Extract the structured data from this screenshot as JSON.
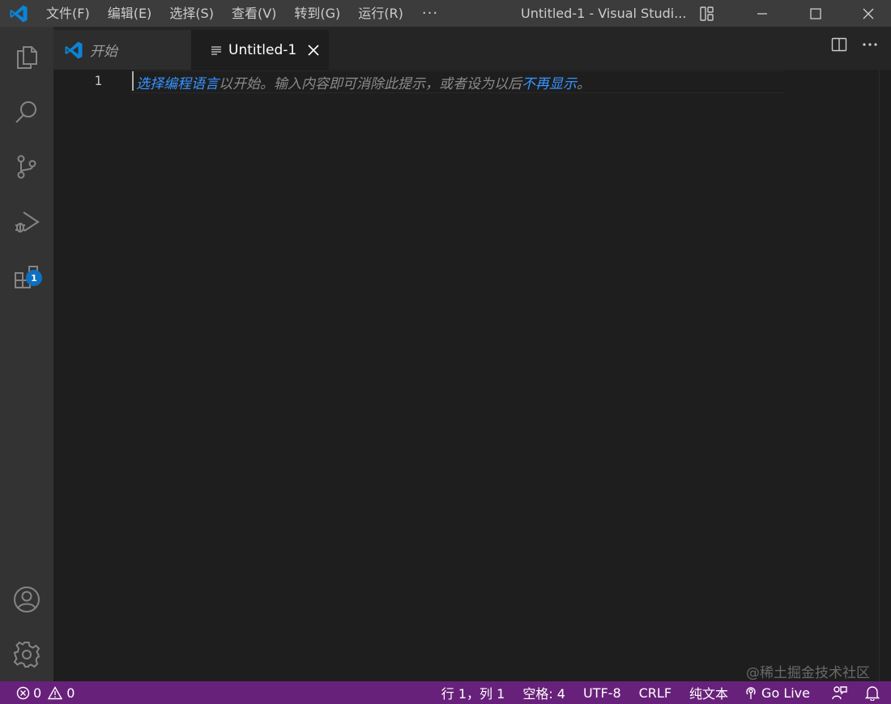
{
  "menu": {
    "items": [
      "文件(F)",
      "编辑(E)",
      "选择(S)",
      "查看(V)",
      "转到(G)",
      "运行(R)"
    ],
    "more_label": "···"
  },
  "window": {
    "title": "Untitled-1 - Visual Studi..."
  },
  "activity_bar": {
    "extensions_badge": "1"
  },
  "tabs": [
    {
      "label": "开始",
      "italic": true,
      "icon": "vscode-logo-icon"
    },
    {
      "label": "Untitled-1",
      "active": true,
      "icon": "file-lines-icon"
    }
  ],
  "editor": {
    "line_numbers": [
      "1"
    ],
    "hint": {
      "link1": "选择编程语言",
      "text1": "以开始。输入内容即可消除此提示，或者设为以后",
      "link2": "不再显示",
      "text2": "。"
    }
  },
  "status_bar": {
    "errors": "0",
    "warnings": "0",
    "position": "行 1，列 1",
    "indent": "空格: 4",
    "encoding": "UTF-8",
    "eol": "CRLF",
    "language": "纯文本",
    "go_live": "Go Live"
  },
  "watermark": "@稀土掘金技术社区",
  "colors": {
    "status_bar": "#68217a",
    "title_bar": "#3c3c3c",
    "activity_bar": "#333333",
    "editor_bg": "#1e1e1e",
    "link": "#3794ff",
    "badge": "#0e70c0"
  }
}
